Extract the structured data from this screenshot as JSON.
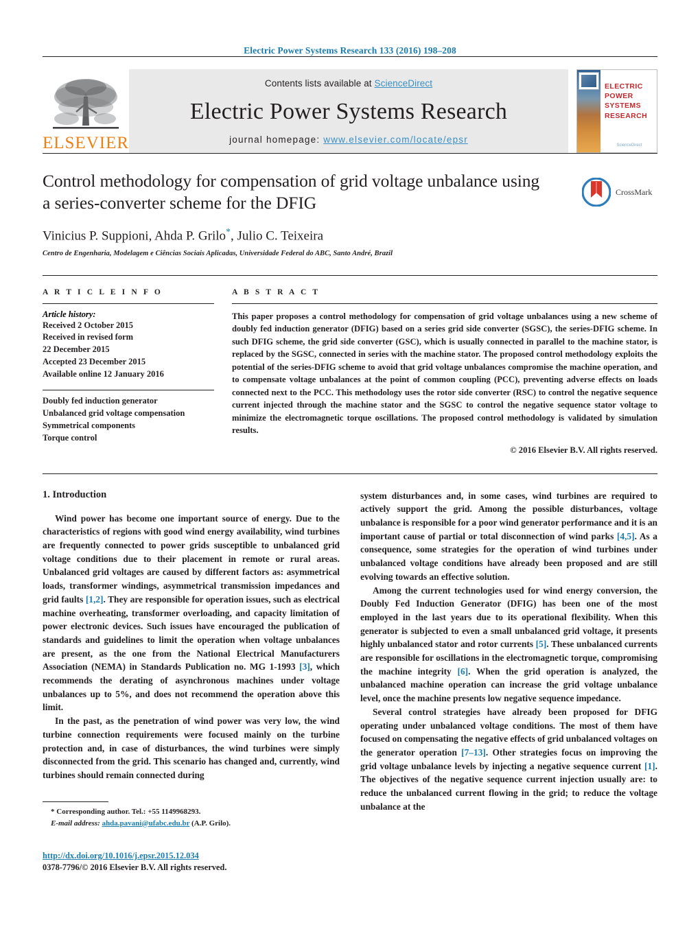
{
  "running_head": "Electric Power Systems Research 133 (2016) 198–208",
  "banner": {
    "publisher_name": "ELSEVIER",
    "contents_prefix": "Contents lists available at ",
    "contents_link": "ScienceDirect",
    "journal_title": "Electric Power Systems Research",
    "homepage_prefix": "journal homepage: ",
    "homepage_url": "www.elsevier.com/locate/epsr",
    "cover_title_line1": "ELECTRIC POWER",
    "cover_title_line2": "SYSTEMS RESEARCH",
    "cover_footer": "ScienceDirect",
    "accent_blue": "#3a8fc4",
    "elsevier_orange": "#ec8013",
    "cover_red": "#c0282d"
  },
  "article": {
    "title": "Control methodology for compensation of grid voltage unbalance using a series-converter scheme for the DFIG",
    "authors": "Vinicius P. Suppioni, Ahda P. Grilo",
    "authors_tail": ", Julio C. Teixeira",
    "corresponding_marker": "*",
    "affiliation": "Centro de Engenharia, Modelagem e Ciências Sociais Aplicadas, Universidade Federal do ABC, Santo André, Brazil",
    "crossmark_label": "CrossMark"
  },
  "article_info": {
    "heading": "A R T I C L E    I N F O",
    "history_label": "Article history:",
    "history": [
      "Received 2 October 2015",
      "Received in revised form",
      "22 December 2015",
      "Accepted 23 December 2015",
      "Available online 12 January 2016"
    ],
    "keywords": [
      "Doubly fed induction generator",
      "Unbalanced grid voltage compensation",
      "Symmetrical components",
      "Torque control"
    ]
  },
  "abstract": {
    "heading": "A B S T R A C T",
    "text": "This paper proposes a control methodology for compensation of grid voltage unbalances using a new scheme of doubly fed induction generator (DFIG) based on a series grid side converter (SGSC), the series-DFIG scheme. In such DFIG scheme, the grid side converter (GSC), which is usually connected in parallel to the machine stator, is replaced by the SGSC, connected in series with the machine stator. The proposed control methodology exploits the potential of the series-DFIG scheme to avoid that grid voltage unbalances compromise the machine operation, and to compensate voltage unbalances at the point of common coupling (PCC), preventing adverse effects on loads connected next to the PCC. This methodology uses the rotor side converter (RSC) to control the negative sequence current injected through the machine stator and the SGSC to control the negative sequence stator voltage to minimize the electromagnetic torque oscillations. The proposed control methodology is validated by simulation results.",
    "copyright": "© 2016 Elsevier B.V. All rights reserved."
  },
  "body": {
    "section_heading": "1.  Introduction",
    "left_paragraphs": [
      "Wind power has become one important source of energy. Due to the characteristics of regions with good wind energy availability, wind turbines are frequently connected to power grids susceptible to unbalanced grid voltage conditions due to their placement in remote or rural areas. Unbalanced grid voltages are caused by different factors as: asymmetrical loads, transformer windings, asymmetrical transmission impedances and grid faults [1,2]. They are responsible for operation issues, such as electrical machine overheating, transformer overloading, and capacity limitation of power electronic devices. Such issues have encouraged the publication of standards and guidelines to limit the operation when voltage unbalances are present, as the one from the National Electrical Manufacturers Association (NEMA) in Standards Publication no. MG 1-1993 [3], which recommends the derating of asynchronous machines under voltage unbalances up to 5%, and does not recommend the operation above this limit.",
      "In the past, as the penetration of wind power was very low, the wind turbine connection requirements were focused mainly on the turbine protection and, in case of disturbances, the wind turbines were simply disconnected from the grid. This scenario has changed and, currently, wind turbines should remain connected during"
    ],
    "right_paragraphs": [
      "system disturbances and, in some cases, wind turbines are required to actively support the grid. Among the possible disturbances, voltage unbalance is responsible for a poor wind generator performance and it is an important cause of partial or total disconnection of wind parks [4,5]. As a consequence, some strategies for the operation of wind turbines under unbalanced voltage conditions have already been proposed and are still evolving towards an effective solution.",
      "Among the current technologies used for wind energy conversion, the Doubly Fed Induction Generator (DFIG) has been one of the most employed in the last years due to its operational flexibility. When this generator is subjected to even a small unbalanced grid voltage, it presents highly unbalanced stator and rotor currents [5]. These unbalanced currents are responsible for oscillations in the electromagnetic torque, compromising the machine integrity [6]. When the grid operation is analyzed, the unbalanced machine operation can increase the grid voltage unbalance level, once the machine presents low negative sequence impedance.",
      "Several control strategies have already been proposed for DFIG operating under unbalanced voltage conditions. The most of them have focused on compensating the negative effects of grid unbalanced voltages on the generator operation [7–13]. Other strategies focus on improving the grid voltage unbalance levels by injecting a negative sequence current [1]. The objectives of the negative sequence current injection usually are: to reduce the unbalanced current flowing in the grid; to reduce the voltage unbalance at the"
    ]
  },
  "footnote": {
    "corresponding": "* Corresponding author. Tel.: +55 1149968293.",
    "email_label": "E-mail address:",
    "email": "ahda.pavani@ufabc.edu.br",
    "email_suffix": "(A.P. Grilo)."
  },
  "footer": {
    "doi": "http://dx.doi.org/10.1016/j.epsr.2015.12.034",
    "issn_line": "0378-7796/© 2016 Elsevier B.V. All rights reserved."
  }
}
